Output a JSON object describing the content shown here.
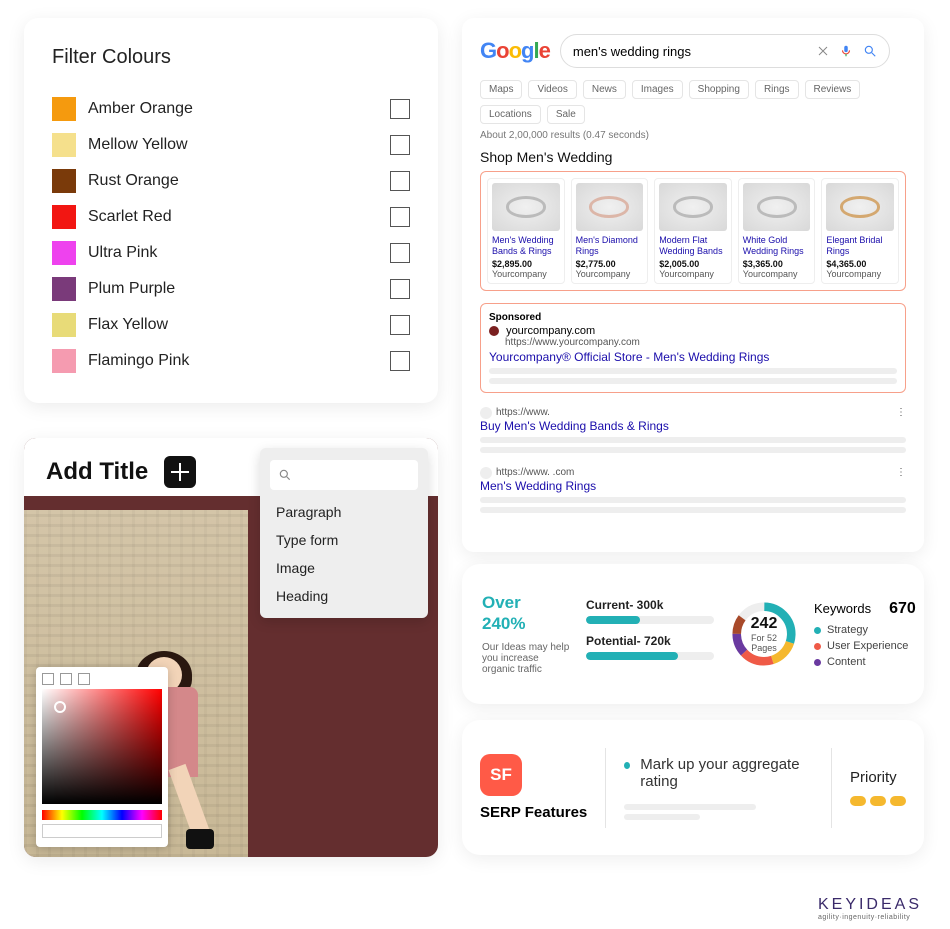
{
  "filter": {
    "title": "Filter Colours",
    "items": [
      {
        "label": "Amber Orange",
        "color": "#f59a0e"
      },
      {
        "label": "Mellow Yellow",
        "color": "#f5e08c"
      },
      {
        "label": "Rust Orange",
        "color": "#7a3a0a"
      },
      {
        "label": "Scarlet Red",
        "color": "#f21612"
      },
      {
        "label": "Ultra Pink",
        "color": "#ee42ee"
      },
      {
        "label": "Plum Purple",
        "color": "#7a3a7a"
      },
      {
        "label": "Flax Yellow",
        "color": "#e8db78"
      },
      {
        "label": "Flamingo Pink",
        "color": "#f59bb0"
      }
    ]
  },
  "add": {
    "title": "Add Title",
    "dropdown": {
      "items": [
        "Paragraph",
        "Type form",
        "Image",
        "Heading"
      ]
    }
  },
  "search": {
    "logo": "Google",
    "query": "men's wedding rings",
    "tabs": [
      "Maps",
      "Videos",
      "News",
      "Images",
      "Shopping",
      "Rings",
      "Reviews",
      "Locations",
      "Sale"
    ],
    "results_meta": "About 2,00,000 results (0.47 seconds)",
    "shop_title": "Shop Men's Wedding",
    "products": [
      {
        "title": "Men's Wedding Bands & Rings",
        "price": "$2,895.00",
        "seller": "Yourcompany"
      },
      {
        "title": "Men's Diamond Rings",
        "price": "$2,775.00",
        "seller": "Yourcompany"
      },
      {
        "title": "Modern Flat Wedding Bands",
        "price": "$2,005.00",
        "seller": "Yourcompany"
      },
      {
        "title": "White Gold Wedding Rings",
        "price": "$3,365.00",
        "seller": "Yourcompany"
      },
      {
        "title": "Elegant Bridal Rings",
        "price": "$4,365.00",
        "seller": "Yourcompany"
      }
    ],
    "sponsored": {
      "label": "Sponsored",
      "domain": "yourcompany.com",
      "url": "https://www.yourcompany.com",
      "link": "Yourcompany® Official Store -  Men's Wedding Rings"
    },
    "results": [
      {
        "url": "https://www.",
        "link": "Buy Men's Wedding Bands & Rings"
      },
      {
        "url": "https://www.            .com",
        "link": "Men's Wedding Rings"
      }
    ]
  },
  "stats": {
    "over_label": "Over",
    "pct": "240%",
    "desc": "Our Ideas may help you increase organic traffic",
    "current_label": "Current- 300k",
    "potential_label": "Potential- 720k",
    "current_pct": 42,
    "potential_pct": 72,
    "donut_value": "242",
    "donut_sub": "For 52 Pages",
    "keywords_label": "Keywords",
    "keywords_value": "670",
    "legend": [
      {
        "label": "Strategy",
        "color": "#22b0b5"
      },
      {
        "label": "User Experience",
        "color": "#ef5a47"
      },
      {
        "label": "Content",
        "color": "#6a3aa0"
      }
    ]
  },
  "serp": {
    "icon": "SF",
    "title": "SERP Features",
    "feature": "Mark up your aggregate rating",
    "priority_label": "Priority"
  },
  "brand": {
    "name": "KEYIDEAS",
    "tag": "agility·ingenuity·reliability"
  }
}
